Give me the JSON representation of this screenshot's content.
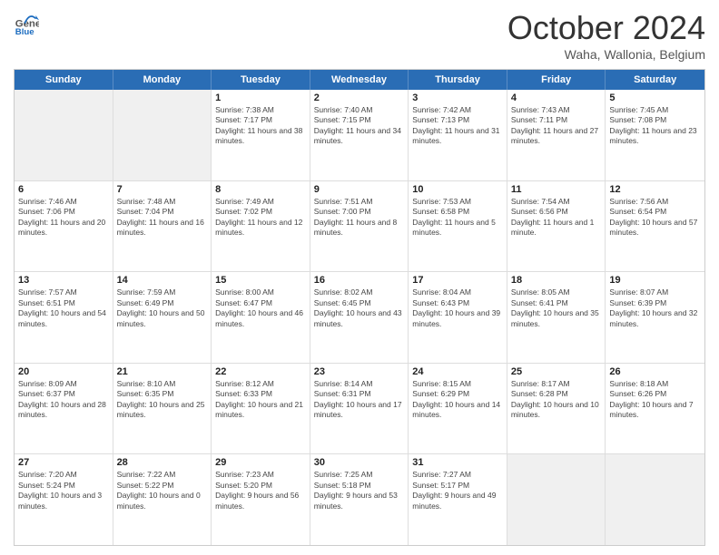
{
  "header": {
    "logo_line1": "General",
    "logo_line2": "Blue",
    "month": "October 2024",
    "location": "Waha, Wallonia, Belgium"
  },
  "days": [
    "Sunday",
    "Monday",
    "Tuesday",
    "Wednesday",
    "Thursday",
    "Friday",
    "Saturday"
  ],
  "weeks": [
    [
      {
        "day": "",
        "sunrise": "",
        "sunset": "",
        "daylight": ""
      },
      {
        "day": "",
        "sunrise": "",
        "sunset": "",
        "daylight": ""
      },
      {
        "day": "1",
        "sunrise": "Sunrise: 7:38 AM",
        "sunset": "Sunset: 7:17 PM",
        "daylight": "Daylight: 11 hours and 38 minutes."
      },
      {
        "day": "2",
        "sunrise": "Sunrise: 7:40 AM",
        "sunset": "Sunset: 7:15 PM",
        "daylight": "Daylight: 11 hours and 34 minutes."
      },
      {
        "day": "3",
        "sunrise": "Sunrise: 7:42 AM",
        "sunset": "Sunset: 7:13 PM",
        "daylight": "Daylight: 11 hours and 31 minutes."
      },
      {
        "day": "4",
        "sunrise": "Sunrise: 7:43 AM",
        "sunset": "Sunset: 7:11 PM",
        "daylight": "Daylight: 11 hours and 27 minutes."
      },
      {
        "day": "5",
        "sunrise": "Sunrise: 7:45 AM",
        "sunset": "Sunset: 7:08 PM",
        "daylight": "Daylight: 11 hours and 23 minutes."
      }
    ],
    [
      {
        "day": "6",
        "sunrise": "Sunrise: 7:46 AM",
        "sunset": "Sunset: 7:06 PM",
        "daylight": "Daylight: 11 hours and 20 minutes."
      },
      {
        "day": "7",
        "sunrise": "Sunrise: 7:48 AM",
        "sunset": "Sunset: 7:04 PM",
        "daylight": "Daylight: 11 hours and 16 minutes."
      },
      {
        "day": "8",
        "sunrise": "Sunrise: 7:49 AM",
        "sunset": "Sunset: 7:02 PM",
        "daylight": "Daylight: 11 hours and 12 minutes."
      },
      {
        "day": "9",
        "sunrise": "Sunrise: 7:51 AM",
        "sunset": "Sunset: 7:00 PM",
        "daylight": "Daylight: 11 hours and 8 minutes."
      },
      {
        "day": "10",
        "sunrise": "Sunrise: 7:53 AM",
        "sunset": "Sunset: 6:58 PM",
        "daylight": "Daylight: 11 hours and 5 minutes."
      },
      {
        "day": "11",
        "sunrise": "Sunrise: 7:54 AM",
        "sunset": "Sunset: 6:56 PM",
        "daylight": "Daylight: 11 hours and 1 minute."
      },
      {
        "day": "12",
        "sunrise": "Sunrise: 7:56 AM",
        "sunset": "Sunset: 6:54 PM",
        "daylight": "Daylight: 10 hours and 57 minutes."
      }
    ],
    [
      {
        "day": "13",
        "sunrise": "Sunrise: 7:57 AM",
        "sunset": "Sunset: 6:51 PM",
        "daylight": "Daylight: 10 hours and 54 minutes."
      },
      {
        "day": "14",
        "sunrise": "Sunrise: 7:59 AM",
        "sunset": "Sunset: 6:49 PM",
        "daylight": "Daylight: 10 hours and 50 minutes."
      },
      {
        "day": "15",
        "sunrise": "Sunrise: 8:00 AM",
        "sunset": "Sunset: 6:47 PM",
        "daylight": "Daylight: 10 hours and 46 minutes."
      },
      {
        "day": "16",
        "sunrise": "Sunrise: 8:02 AM",
        "sunset": "Sunset: 6:45 PM",
        "daylight": "Daylight: 10 hours and 43 minutes."
      },
      {
        "day": "17",
        "sunrise": "Sunrise: 8:04 AM",
        "sunset": "Sunset: 6:43 PM",
        "daylight": "Daylight: 10 hours and 39 minutes."
      },
      {
        "day": "18",
        "sunrise": "Sunrise: 8:05 AM",
        "sunset": "Sunset: 6:41 PM",
        "daylight": "Daylight: 10 hours and 35 minutes."
      },
      {
        "day": "19",
        "sunrise": "Sunrise: 8:07 AM",
        "sunset": "Sunset: 6:39 PM",
        "daylight": "Daylight: 10 hours and 32 minutes."
      }
    ],
    [
      {
        "day": "20",
        "sunrise": "Sunrise: 8:09 AM",
        "sunset": "Sunset: 6:37 PM",
        "daylight": "Daylight: 10 hours and 28 minutes."
      },
      {
        "day": "21",
        "sunrise": "Sunrise: 8:10 AM",
        "sunset": "Sunset: 6:35 PM",
        "daylight": "Daylight: 10 hours and 25 minutes."
      },
      {
        "day": "22",
        "sunrise": "Sunrise: 8:12 AM",
        "sunset": "Sunset: 6:33 PM",
        "daylight": "Daylight: 10 hours and 21 minutes."
      },
      {
        "day": "23",
        "sunrise": "Sunrise: 8:14 AM",
        "sunset": "Sunset: 6:31 PM",
        "daylight": "Daylight: 10 hours and 17 minutes."
      },
      {
        "day": "24",
        "sunrise": "Sunrise: 8:15 AM",
        "sunset": "Sunset: 6:29 PM",
        "daylight": "Daylight: 10 hours and 14 minutes."
      },
      {
        "day": "25",
        "sunrise": "Sunrise: 8:17 AM",
        "sunset": "Sunset: 6:28 PM",
        "daylight": "Daylight: 10 hours and 10 minutes."
      },
      {
        "day": "26",
        "sunrise": "Sunrise: 8:18 AM",
        "sunset": "Sunset: 6:26 PM",
        "daylight": "Daylight: 10 hours and 7 minutes."
      }
    ],
    [
      {
        "day": "27",
        "sunrise": "Sunrise: 7:20 AM",
        "sunset": "Sunset: 5:24 PM",
        "daylight": "Daylight: 10 hours and 3 minutes."
      },
      {
        "day": "28",
        "sunrise": "Sunrise: 7:22 AM",
        "sunset": "Sunset: 5:22 PM",
        "daylight": "Daylight: 10 hours and 0 minutes."
      },
      {
        "day": "29",
        "sunrise": "Sunrise: 7:23 AM",
        "sunset": "Sunset: 5:20 PM",
        "daylight": "Daylight: 9 hours and 56 minutes."
      },
      {
        "day": "30",
        "sunrise": "Sunrise: 7:25 AM",
        "sunset": "Sunset: 5:18 PM",
        "daylight": "Daylight: 9 hours and 53 minutes."
      },
      {
        "day": "31",
        "sunrise": "Sunrise: 7:27 AM",
        "sunset": "Sunset: 5:17 PM",
        "daylight": "Daylight: 9 hours and 49 minutes."
      },
      {
        "day": "",
        "sunrise": "",
        "sunset": "",
        "daylight": ""
      },
      {
        "day": "",
        "sunrise": "",
        "sunset": "",
        "daylight": ""
      }
    ]
  ]
}
